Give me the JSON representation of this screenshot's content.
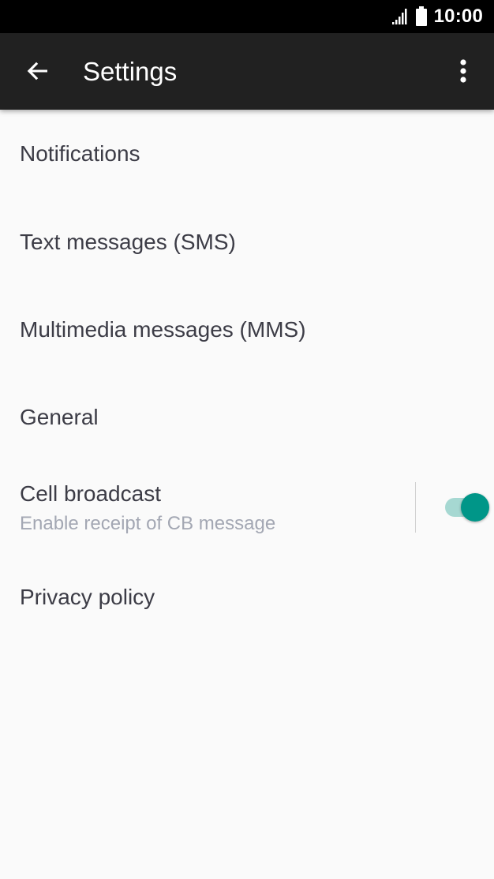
{
  "status_bar": {
    "time": "10:00",
    "signal_icon": "signal-icon",
    "battery_icon": "battery-icon"
  },
  "app_bar": {
    "title": "Settings",
    "back_icon": "arrow-back-icon",
    "overflow_icon": "more-vert-icon"
  },
  "settings": {
    "items": [
      {
        "label": "Notifications"
      },
      {
        "label": "Text messages (SMS)"
      },
      {
        "label": "Multimedia messages (MMS)"
      },
      {
        "label": "General"
      }
    ],
    "cell_broadcast": {
      "label": "Cell broadcast",
      "summary": "Enable receipt of CB message",
      "enabled": true
    },
    "privacy_policy": {
      "label": "Privacy policy"
    }
  },
  "colors": {
    "status_bar": "#000000",
    "app_bar": "#212121",
    "background": "#fafafa",
    "primary_text": "#3c3c46",
    "secondary_text": "#a3a7b3",
    "toggle_accent": "#009688",
    "toggle_track": "#a6d8d2"
  }
}
